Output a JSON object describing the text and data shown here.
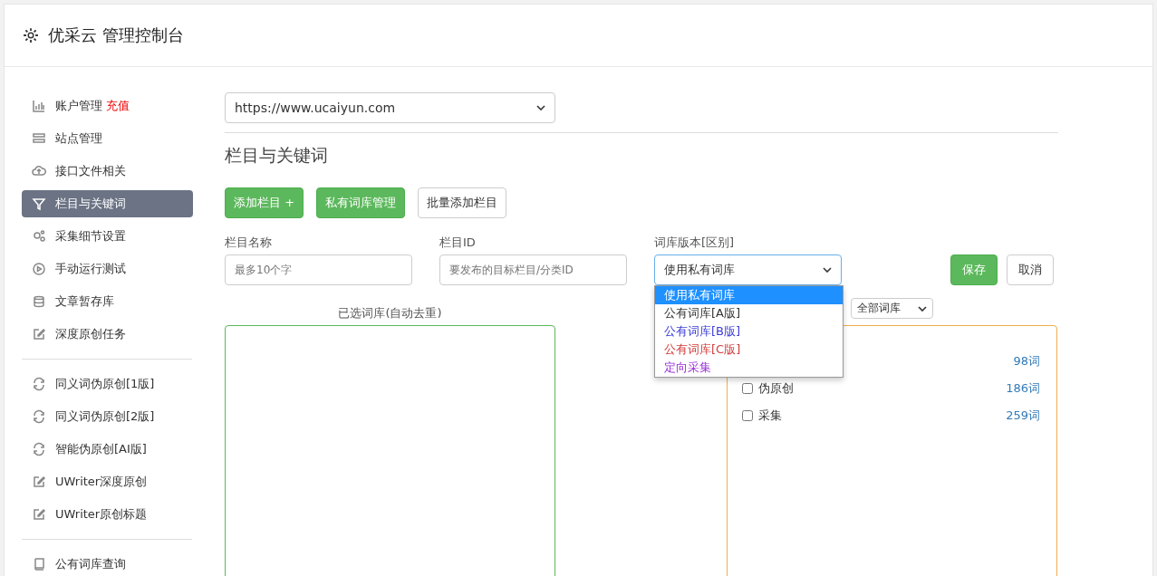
{
  "header": {
    "title": "优采云 管理控制台"
  },
  "sidebar": {
    "groups": [
      {
        "items": [
          {
            "label": "账户管理",
            "badge": "充值",
            "selected": false
          },
          {
            "label": "站点管理",
            "selected": false
          },
          {
            "label": "接口文件相关",
            "selected": false
          },
          {
            "label": "栏目与关键词",
            "selected": true
          },
          {
            "label": "采集细节设置",
            "selected": false
          },
          {
            "label": "手动运行测试",
            "selected": false
          },
          {
            "label": "文章暂存库",
            "selected": false
          },
          {
            "label": "深度原创任务",
            "selected": false
          }
        ]
      },
      {
        "items": [
          {
            "label": "同义词伪原创[1版]",
            "selected": false
          },
          {
            "label": "同义词伪原创[2版]",
            "selected": false
          },
          {
            "label": "智能伪原创[AI版]",
            "selected": false
          },
          {
            "label": "UWriter深度原创",
            "selected": false
          },
          {
            "label": "UWriter原创标题",
            "selected": false
          }
        ]
      },
      {
        "items": [
          {
            "label": "公有词库查询",
            "selected": false
          }
        ]
      }
    ]
  },
  "site_select": {
    "value": "https://www.ucaiyun.com"
  },
  "section_title": "栏目与关键词",
  "buttons": [
    {
      "label": "添加栏目 +",
      "kind": "primary"
    },
    {
      "label": "私有词库管理",
      "kind": "primary"
    },
    {
      "label": "批量添加栏目",
      "kind": "default"
    }
  ],
  "form": {
    "name_field": {
      "label": "栏目名称",
      "placeholder": "最多10个字"
    },
    "id_field": {
      "label": "栏目ID",
      "placeholder": "要发布的目标栏目/分类ID"
    },
    "version_select": {
      "label": "词库版本[区别]",
      "value": "使用私有词库",
      "expanded": true,
      "options": [
        {
          "label": "使用私有词库",
          "selected": true
        },
        {
          "label": "公有词库[A版]",
          "selected": false,
          "color": "#333333"
        },
        {
          "label": "公有词库[B版]",
          "selected": false,
          "color": "#3b3bd6"
        },
        {
          "label": "公有词库[C版]",
          "selected": false,
          "color": "#d23c3c"
        },
        {
          "label": "定向采集",
          "selected": false,
          "color": "#9a2fd6"
        }
      ]
    },
    "save_button": "保存",
    "cancel_button": "取消"
  },
  "selected_panel": {
    "title": "已选词库(自动去重)"
  },
  "library_panel": {
    "filter_select": "全部词库",
    "rows": [
      {
        "count": "98词"
      },
      {
        "label": "伪原创",
        "count": "186词",
        "checked": false
      },
      {
        "label": "采集",
        "count": "259词",
        "checked": false
      }
    ]
  }
}
